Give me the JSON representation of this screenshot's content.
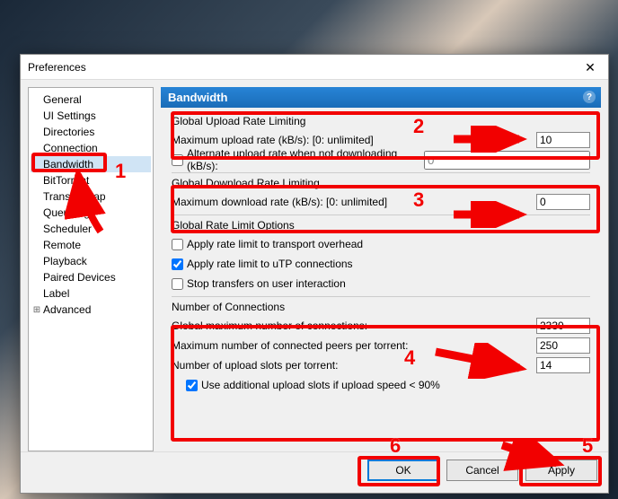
{
  "window": {
    "title": "Preferences"
  },
  "tree": {
    "items": [
      {
        "label": "General"
      },
      {
        "label": "UI Settings"
      },
      {
        "label": "Directories"
      },
      {
        "label": "Connection"
      },
      {
        "label": "Bandwidth",
        "selected": true
      },
      {
        "label": "BitTorrent"
      },
      {
        "label": "Transfer Cap"
      },
      {
        "label": "Queueing"
      },
      {
        "label": "Scheduler"
      },
      {
        "label": "Remote"
      },
      {
        "label": "Playback"
      },
      {
        "label": "Paired Devices"
      },
      {
        "label": "Label"
      },
      {
        "label": "Advanced",
        "expandable": true
      }
    ]
  },
  "header": {
    "title": "Bandwidth"
  },
  "upload": {
    "title": "Global Upload Rate Limiting",
    "max_label": "Maximum upload rate (kB/s): [0: unlimited]",
    "max_value": "10",
    "alt_label": "Alternate upload rate when not downloading (kB/s):",
    "alt_checked": false,
    "alt_value": "0"
  },
  "download": {
    "title": "Global Download Rate Limiting",
    "max_label": "Maximum download rate (kB/s): [0: unlimited]",
    "max_value": "0"
  },
  "options": {
    "title": "Global Rate Limit Options",
    "overhead_label": "Apply rate limit to transport overhead",
    "overhead_checked": false,
    "utp_label": "Apply rate limit to uTP connections",
    "utp_checked": true,
    "stop_label": "Stop transfers on user interaction",
    "stop_checked": false
  },
  "connections": {
    "title": "Number of Connections",
    "global_label": "Global maximum number of connections:",
    "global_value": "2330",
    "peers_label": "Maximum number of connected peers per torrent:",
    "peers_value": "250",
    "slots_label": "Number of upload slots per torrent:",
    "slots_value": "14",
    "extra_label": "Use additional upload slots if upload speed < 90%",
    "extra_checked": true
  },
  "buttons": {
    "ok": "OK",
    "cancel": "Cancel",
    "apply": "Apply"
  },
  "annotations": {
    "n1": "1",
    "n2": "2",
    "n3": "3",
    "n4": "4",
    "n5": "5",
    "n6": "6"
  }
}
